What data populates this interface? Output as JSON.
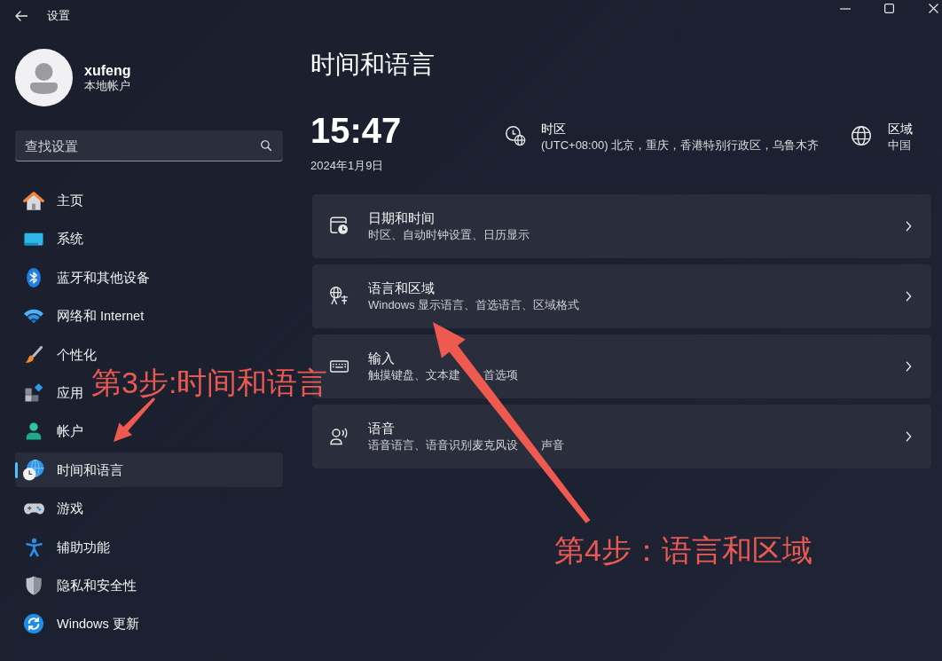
{
  "window": {
    "title": "设置"
  },
  "account": {
    "name": "xufeng",
    "type": "本地帐户"
  },
  "search": {
    "placeholder": "查找设置"
  },
  "sidebar": {
    "items": [
      {
        "kind": "home",
        "label": "主页",
        "selected": false
      },
      {
        "kind": "system",
        "label": "系统",
        "selected": false
      },
      {
        "kind": "bluetooth",
        "label": "蓝牙和其他设备",
        "selected": false
      },
      {
        "kind": "network",
        "label": "网络和 Internet",
        "selected": false
      },
      {
        "kind": "personalization",
        "label": "个性化",
        "selected": false
      },
      {
        "kind": "apps",
        "label": "应用",
        "selected": false
      },
      {
        "kind": "accounts",
        "label": "帐户",
        "selected": false
      },
      {
        "kind": "time",
        "label": "时间和语言",
        "selected": true
      },
      {
        "kind": "gaming",
        "label": "游戏",
        "selected": false
      },
      {
        "kind": "accessibility",
        "label": "辅助功能",
        "selected": false
      },
      {
        "kind": "privacy",
        "label": "隐私和安全性",
        "selected": false
      },
      {
        "kind": "update",
        "label": "Windows 更新",
        "selected": false
      }
    ]
  },
  "page": {
    "title": "时间和语言",
    "time": "15:47",
    "date": "2024年1月9日",
    "time_zone": {
      "label": "时区",
      "value": "(UTC+08:00) 北京，重庆，香港特别行政区，乌鲁木齐"
    },
    "region": {
      "label": "区域",
      "value": "中国"
    }
  },
  "cards": [
    {
      "kind": "datetime",
      "title": "日期和时间",
      "description": [
        "时区、自动时钟设置、日历显示"
      ]
    },
    {
      "kind": "language",
      "title": "语言和区域",
      "description": [
        "Windows 显示语言、首选语言、区域格式"
      ]
    },
    {
      "kind": "typing",
      "title": "输入",
      "description": [
        "触摸键盘、文本建",
        "首选项"
      ]
    },
    {
      "kind": "speech",
      "title": "语音",
      "description": [
        "语音语言、语音识别麦克风设",
        "声音"
      ]
    }
  ],
  "annotations": [
    {
      "text": "第3步:时间和语言"
    },
    {
      "text": "第4步：语言和区域"
    }
  ]
}
